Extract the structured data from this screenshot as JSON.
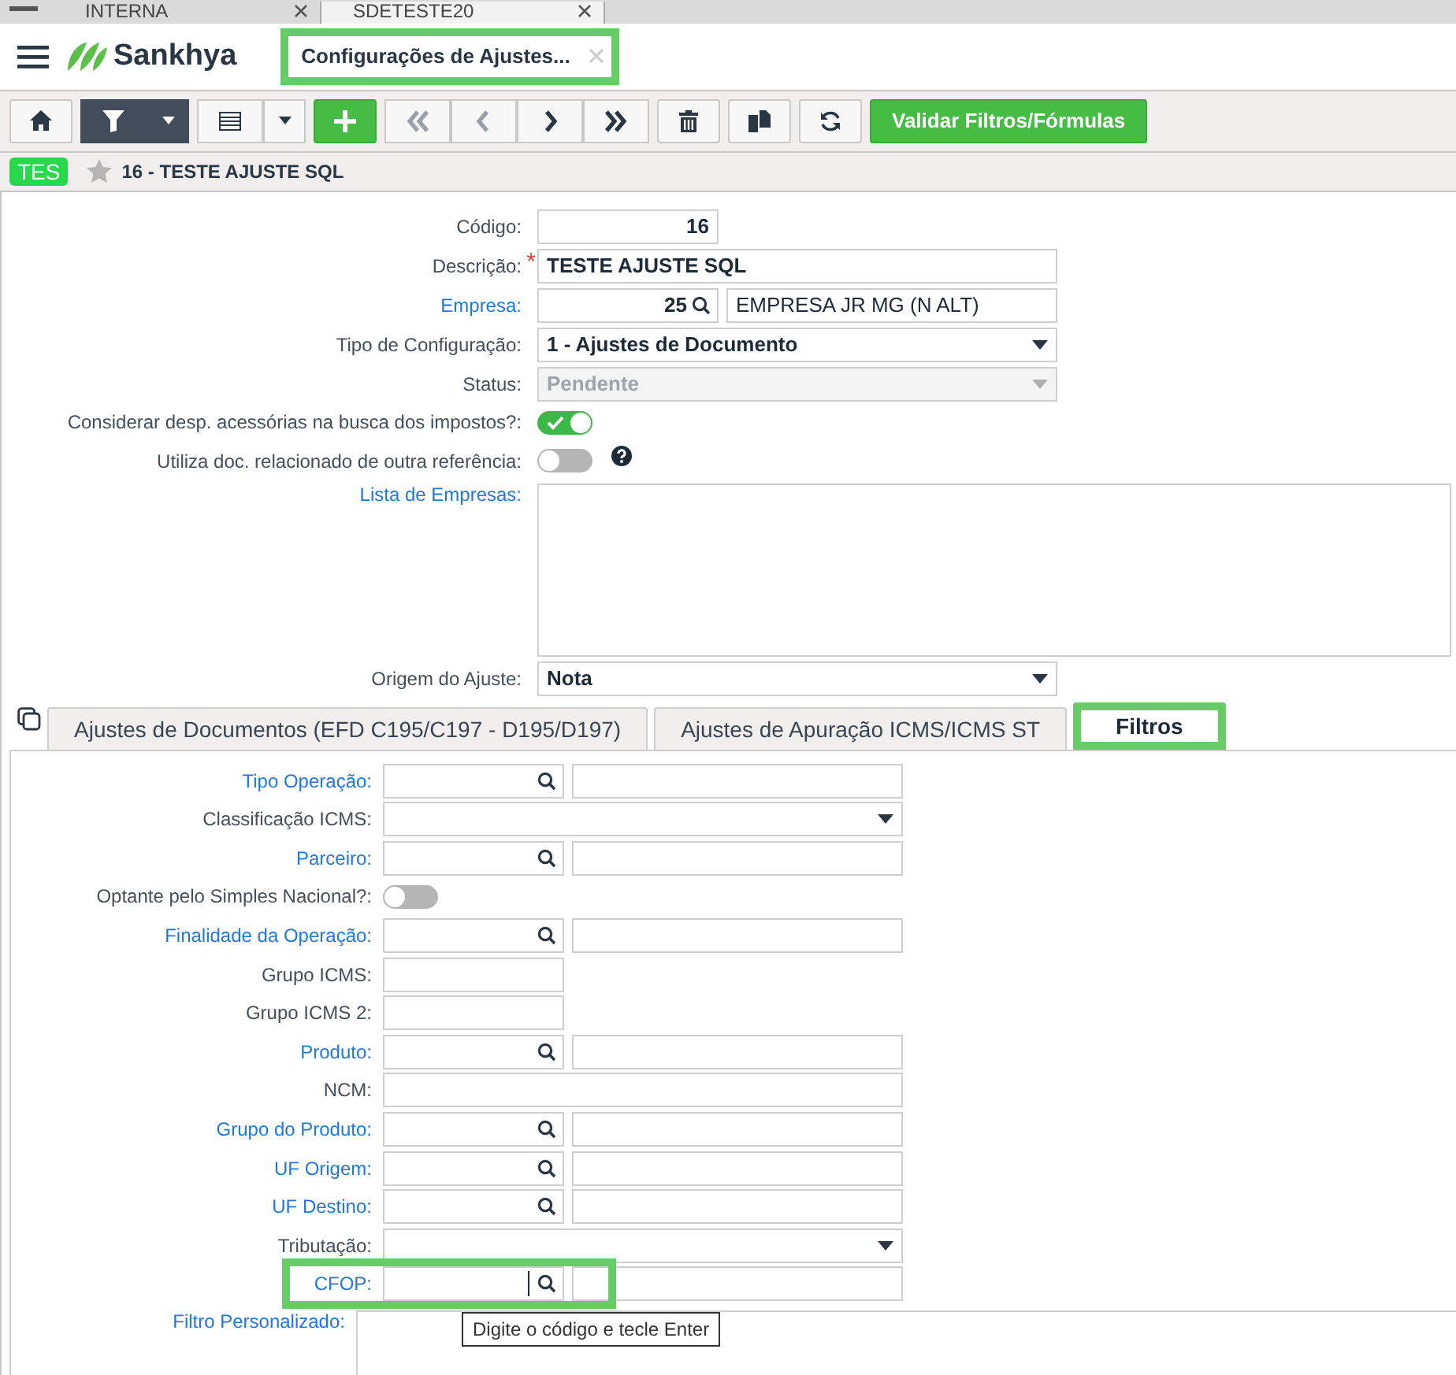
{
  "browser_tabs": [
    {
      "label": "INTERNA",
      "selected": false
    },
    {
      "label": "SDETESTE20",
      "selected": true
    }
  ],
  "header": {
    "brand": "Sankhya",
    "page_tab": {
      "label": "Configurações de Ajustes...",
      "highlighted": true
    }
  },
  "toolbar": {
    "nav": [
      {
        "kind": "first",
        "disabled": true
      },
      {
        "kind": "prev",
        "disabled": true
      },
      {
        "kind": "next",
        "disabled": false
      },
      {
        "kind": "last",
        "disabled": false
      }
    ],
    "primary_action": "Validar Filtros/Fórmulas"
  },
  "record": {
    "badge": "TES",
    "title": "16 - TESTE AJUSTE SQL"
  },
  "form": [
    {
      "label": "Código:",
      "kind": "number",
      "link": false,
      "value": "16"
    },
    {
      "label": "Descrição:",
      "kind": "text",
      "link": false,
      "required_mark": "*",
      "value": "TESTE AJUSTE SQL"
    },
    {
      "label": "Empresa:",
      "kind": "lookup",
      "link": true,
      "value": "25",
      "description": "EMPRESA JR MG (N ALT)"
    },
    {
      "label": "Tipo de Configuração:",
      "kind": "select",
      "link": false,
      "value": "1 - Ajustes de Documento",
      "disabled": false
    },
    {
      "label": "Status:",
      "kind": "select",
      "link": false,
      "value": "Pendente",
      "disabled": true
    },
    {
      "label": "Considerar desp. acessórias na busca dos impostos?:",
      "kind": "toggle",
      "link": false,
      "on": true,
      "help": false
    },
    {
      "label": "Utiliza doc. relacionado de outra referência:",
      "kind": "toggle",
      "link": false,
      "on": false,
      "help": true
    },
    {
      "label": "Lista de Empresas:",
      "kind": "textarea",
      "link": true
    },
    {
      "label": "Origem do Ajuste:",
      "kind": "select",
      "link": false,
      "value": "Nota",
      "disabled": false
    }
  ],
  "tabs": [
    {
      "label": "Ajustes de Documentos (EFD C195/C197 - D195/D197)",
      "selected": false,
      "highlighted": false
    },
    {
      "label": "Ajustes de Apuração ICMS/ICMS ST",
      "selected": false,
      "highlighted": false
    },
    {
      "label": "Filtros",
      "selected": true,
      "highlighted": true
    }
  ],
  "filters": [
    {
      "label": "Tipo Operação:",
      "kind": "lookup",
      "link": true,
      "highlighted": false
    },
    {
      "label": "Classificação ICMS:",
      "kind": "select",
      "link": false,
      "highlighted": false
    },
    {
      "label": "Parceiro:",
      "kind": "lookup",
      "link": true,
      "highlighted": false
    },
    {
      "label": "Optante pelo Simples Nacional?:",
      "kind": "toggle",
      "link": false,
      "on": false,
      "highlighted": false
    },
    {
      "label": "Finalidade da Operação:",
      "kind": "lookup",
      "link": true,
      "highlighted": false
    },
    {
      "label": "Grupo ICMS:",
      "kind": "short",
      "link": false,
      "highlighted": false
    },
    {
      "label": "Grupo ICMS 2:",
      "kind": "short",
      "link": false,
      "highlighted": false
    },
    {
      "label": "Produto:",
      "kind": "lookup",
      "link": true,
      "highlighted": false
    },
    {
      "label": "NCM:",
      "kind": "wide",
      "link": false,
      "highlighted": false
    },
    {
      "label": "Grupo do Produto:",
      "kind": "lookup",
      "link": true,
      "highlighted": false
    },
    {
      "label": "UF Origem:",
      "kind": "lookup",
      "link": true,
      "highlighted": false
    },
    {
      "label": "UF Destino:",
      "kind": "lookup",
      "link": true,
      "highlighted": false
    },
    {
      "label": "Tributação:",
      "kind": "select",
      "link": false,
      "highlighted": false
    },
    {
      "label": "CFOP:",
      "kind": "lookup",
      "link": true,
      "highlighted": true
    },
    {
      "label": "Filtro Personalizado:",
      "kind": "textarea",
      "link": true,
      "highlighted": false
    }
  ],
  "tooltip": "Digite o código e tecle Enter"
}
